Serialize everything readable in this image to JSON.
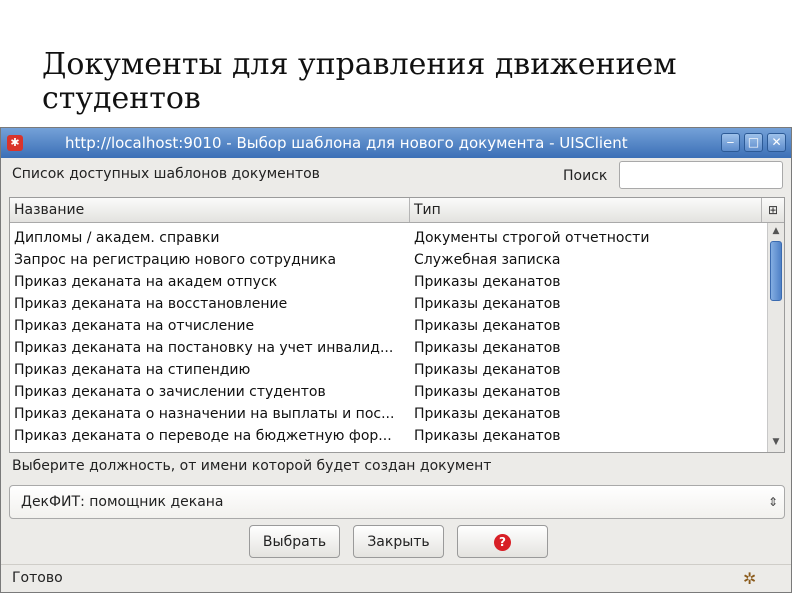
{
  "slide": {
    "title": "Документы для управления движением студентов"
  },
  "window": {
    "title": "http://localhost:9010 - Выбор шаблона для нового документа - UISClient",
    "controls": {
      "minimize": "‒",
      "maximize": "□",
      "close": "✕"
    }
  },
  "templates": {
    "label": "Список доступных шаблонов документов",
    "search_label": "Поиск",
    "search_value": "",
    "columns": {
      "name": "Название",
      "type": "Тип"
    },
    "rows": [
      {
        "name": "Дипломы / академ. справки",
        "type": "Документы строгой отчетности"
      },
      {
        "name": "Запрос на регистрацию нового сотрудника",
        "type": "Служебная записка"
      },
      {
        "name": "Приказ деканата на академ отпуск",
        "type": "Приказы деканатов"
      },
      {
        "name": "Приказ деканата на восстановление",
        "type": "Приказы деканатов"
      },
      {
        "name": "Приказ деканата на отчисление",
        "type": "Приказы деканатов"
      },
      {
        "name": "Приказ деканата на постановку на учет инвалид...",
        "type": "Приказы деканатов"
      },
      {
        "name": "Приказ деканата на стипендию",
        "type": "Приказы деканатов"
      },
      {
        "name": "Приказ деканата о зачислении студентов",
        "type": "Приказы деканатов"
      },
      {
        "name": "Приказ деканата о назначении на выплаты и пос...",
        "type": "Приказы деканатов"
      },
      {
        "name": "Приказ деканата о переводе на бюджетную фор...",
        "type": "Приказы деканатов"
      }
    ]
  },
  "position": {
    "label": "Выберите должность, от имени которой будет создан документ",
    "selected": "ДекФИТ: помощник декана"
  },
  "buttons": {
    "select": "Выбрать",
    "close": "Закрыть",
    "help": "?"
  },
  "status": {
    "text": "Готово"
  },
  "colors": {
    "titlebar": "#3b6fb6",
    "scroll_thumb": "#4f81c7",
    "help": "#d81f26"
  }
}
